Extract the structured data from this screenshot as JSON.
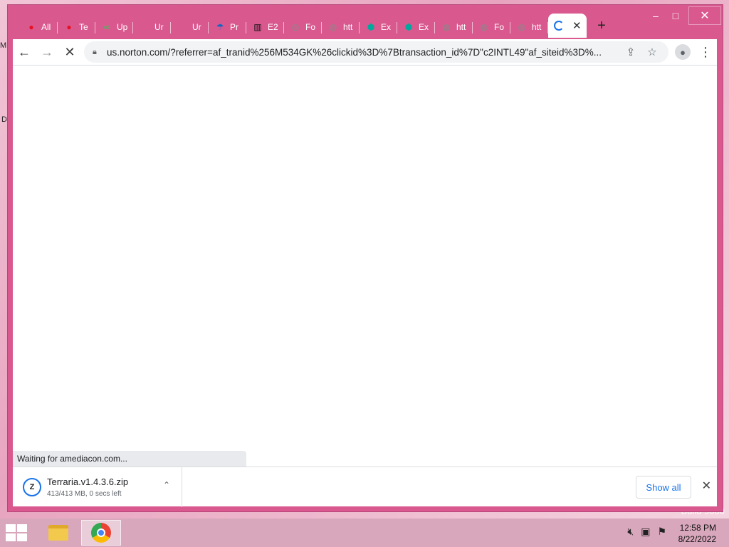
{
  "desktop": {
    "left_edge_text_1": "M",
    "left_edge_text_2": "D",
    "build_text": "Build 9600"
  },
  "window": {
    "controls": {
      "minimize": "–",
      "maximize": "□",
      "close": "✕"
    }
  },
  "tabs": [
    {
      "label": "All",
      "icon": "red-mascot-icon",
      "color": "#e81123"
    },
    {
      "label": "Te",
      "icon": "red-mascot-icon",
      "color": "#e81123"
    },
    {
      "label": "Up",
      "icon": "green-logo-icon",
      "color": "#34c759"
    },
    {
      "label": "Ur",
      "icon": "",
      "color": ""
    },
    {
      "label": "Ur",
      "icon": "",
      "color": ""
    },
    {
      "label": "Pr",
      "icon": "blue-umbrella-icon",
      "color": "#1565c0"
    },
    {
      "label": "E2",
      "icon": "bank-icon",
      "color": "#111111"
    },
    {
      "label": "Fo",
      "icon": "globe-icon",
      "color": "#888888"
    },
    {
      "label": "htt",
      "icon": "globe-icon",
      "color": "#888888"
    },
    {
      "label": "Ex",
      "icon": "teal-shield-icon",
      "color": "#00a99d"
    },
    {
      "label": "Ex",
      "icon": "teal-shield-icon",
      "color": "#00a99d"
    },
    {
      "label": "htt",
      "icon": "globe-icon",
      "color": "#888888"
    },
    {
      "label": "Fo",
      "icon": "globe-icon",
      "color": "#888888"
    },
    {
      "label": "htt",
      "icon": "globe-icon",
      "color": "#888888"
    }
  ],
  "active_tab": {
    "close": "✕"
  },
  "new_tab": "+",
  "toolbar": {
    "back": "←",
    "forward": "→",
    "stop": "✕",
    "url": "us.norton.com/?referrer=af_tranid%256M534GK%26clickid%3D%7Btransaction_id%7D\"c2INTL49\"af_siteid%3D%...",
    "share": "⇪",
    "star": "☆",
    "profile": "●",
    "menu": "⋮"
  },
  "status": {
    "text": "Waiting for amediacon.com..."
  },
  "download": {
    "filename": "Terraria.v1.4.3.6.zip",
    "status": "413/413 MB, 0 secs left",
    "icon_letter": "Z",
    "chevron": "⌃",
    "show_all": "Show all",
    "close": "✕"
  },
  "taskbar": {
    "time": "12:58 PM",
    "date": "8/22/2022",
    "tray_icons": [
      "volume-muted-icon",
      "network-icon",
      "action-center-flag-icon"
    ]
  }
}
